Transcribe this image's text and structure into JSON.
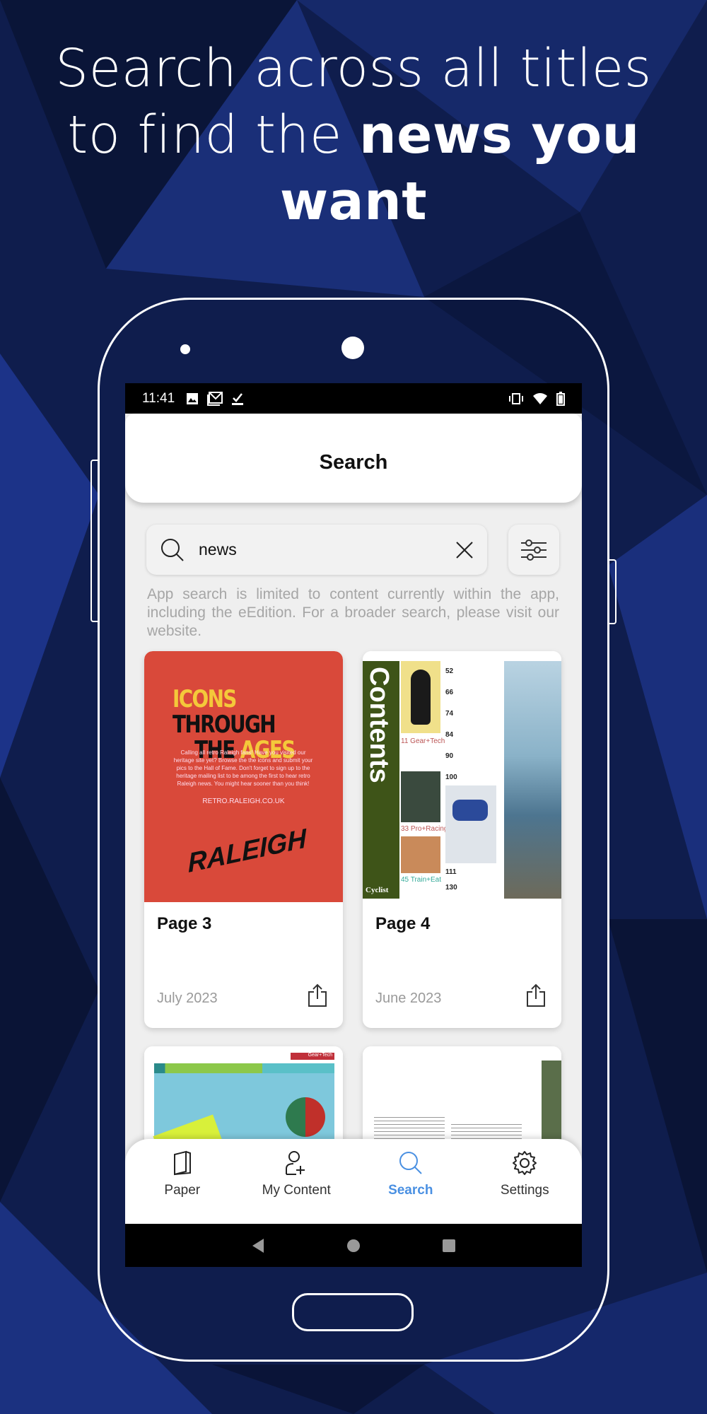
{
  "headline": {
    "line1": "Search across all titles",
    "line2_normal": "to find the ",
    "line2_bold": "news you",
    "line3_bold": "want"
  },
  "status_bar": {
    "time": "11:41",
    "left_icons": [
      "image-icon",
      "gmail-icon",
      "check-icon"
    ],
    "right_icons": [
      "vibrate-icon",
      "wifi-icon",
      "battery-icon"
    ]
  },
  "header": {
    "title": "Search"
  },
  "search": {
    "value": "news",
    "search_icon": "search-icon",
    "clear_icon": "close-icon",
    "filter_icon": "sliders-icon"
  },
  "help_text": "App search is limited to content currently within the app, including the eEdition. For a broader search, please visit our website.",
  "results": [
    {
      "title": "Page 3",
      "date": "July 2023",
      "thumb": {
        "headline_a": "ICONS",
        "headline_b": "THROUGH",
        "headline_c": "THE",
        "headline_d": "AGES",
        "body": "Calling all retro Raleigh fans! Have you visited our heritage site yet? Browse the the icons and submit your pics to the Hall of Fame. Don't forget to sign up to the heritage mailing list to be among the first to hear retro Raleigh news. You might hear sooner than you think!",
        "url": "RETRO.RALEIGH.CO.UK",
        "brand": "RALEIGH",
        "bg": "#d9493a"
      }
    },
    {
      "title": "Page 4",
      "date": "June 2023",
      "thumb": {
        "side_title": "Contents",
        "sections": [
          "11 Gear+Tech",
          "33 Pro+Racing",
          "45 Train+Eat"
        ],
        "numbers": [
          "52",
          "66",
          "74",
          "84",
          "90",
          "100",
          "111",
          "130"
        ],
        "logo": "Cyclist",
        "bg": "#3e5418"
      }
    },
    {
      "title": "",
      "date": "",
      "thumb": {
        "tag": "Gear+Tech"
      }
    },
    {
      "title": "",
      "date": "",
      "thumb": {}
    }
  ],
  "nav": [
    {
      "label": "Paper",
      "icon": "paper-icon",
      "active": false
    },
    {
      "label": "My Content",
      "icon": "add-user-icon",
      "active": false
    },
    {
      "label": "Search",
      "icon": "search-icon",
      "active": true
    },
    {
      "label": "Settings",
      "icon": "gear-icon",
      "active": false
    }
  ],
  "colors": {
    "accent": "#4a90e2",
    "background": "#0d1a45"
  }
}
